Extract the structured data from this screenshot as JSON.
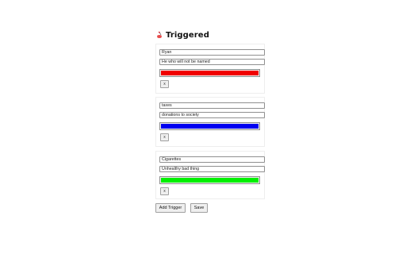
{
  "header": {
    "title": "Triggered",
    "icon": "triggered-logo-icon"
  },
  "triggers": [
    {
      "name": "Ryan",
      "replacement": "He who will not be named",
      "color": "#f00000",
      "remove_label": "x"
    },
    {
      "name": "taxes",
      "replacement": "donations to society",
      "color": "#0000f0",
      "remove_label": "x"
    },
    {
      "name": "Cigarettes",
      "replacement": "Unhealthy bad thing",
      "color": "#00f000",
      "remove_label": "x"
    }
  ],
  "actions": {
    "add_trigger_label": "Add Trigger",
    "save_label": "Save"
  }
}
